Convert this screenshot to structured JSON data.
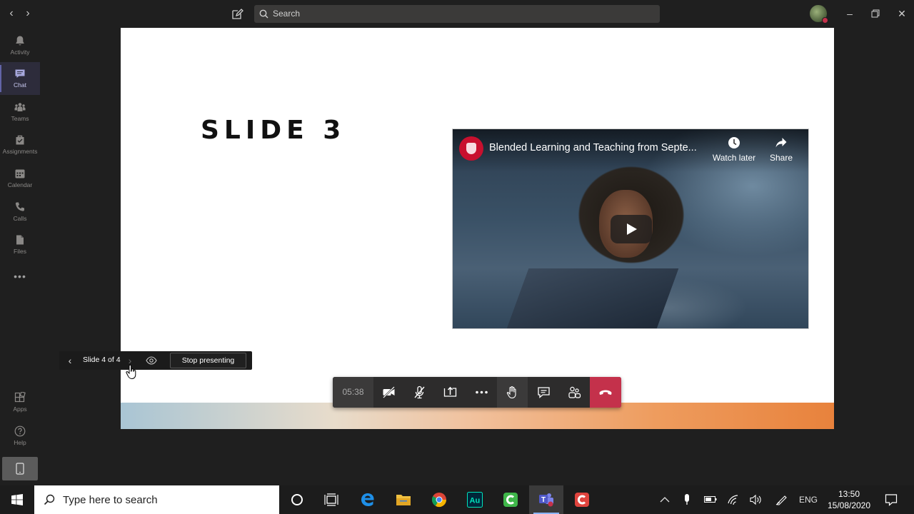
{
  "titlebar": {
    "search_label": "Search"
  },
  "rail": {
    "items": [
      {
        "label": "Activity",
        "icon": "bell-icon"
      },
      {
        "label": "Chat",
        "icon": "chat-icon",
        "active": true
      },
      {
        "label": "Teams",
        "icon": "teams-icon"
      },
      {
        "label": "Assignments",
        "icon": "assignments-icon"
      },
      {
        "label": "Calendar",
        "icon": "calendar-icon"
      },
      {
        "label": "Calls",
        "icon": "phone-icon"
      },
      {
        "label": "Files",
        "icon": "file-icon"
      }
    ],
    "more": "•••",
    "bottom": [
      {
        "label": "Apps",
        "icon": "apps-icon"
      },
      {
        "label": "Help",
        "icon": "help-icon"
      }
    ]
  },
  "slide": {
    "title": "SLIDE 3"
  },
  "video": {
    "title": "Blended Learning and Teaching from Septe...",
    "watch_later": "Watch later",
    "share": "Share"
  },
  "presenter": {
    "slide_count": "Slide 4 of 4",
    "stop_label": "Stop presenting"
  },
  "controls": {
    "timer": "05:38"
  },
  "taskbar": {
    "search_placeholder": "Type here to search",
    "language": "ENG",
    "time": "13:50",
    "date": "15/08/2020"
  },
  "colors": {
    "accent": "#6264a7",
    "hangup": "#c4314b",
    "background": "#1f1f1f"
  }
}
